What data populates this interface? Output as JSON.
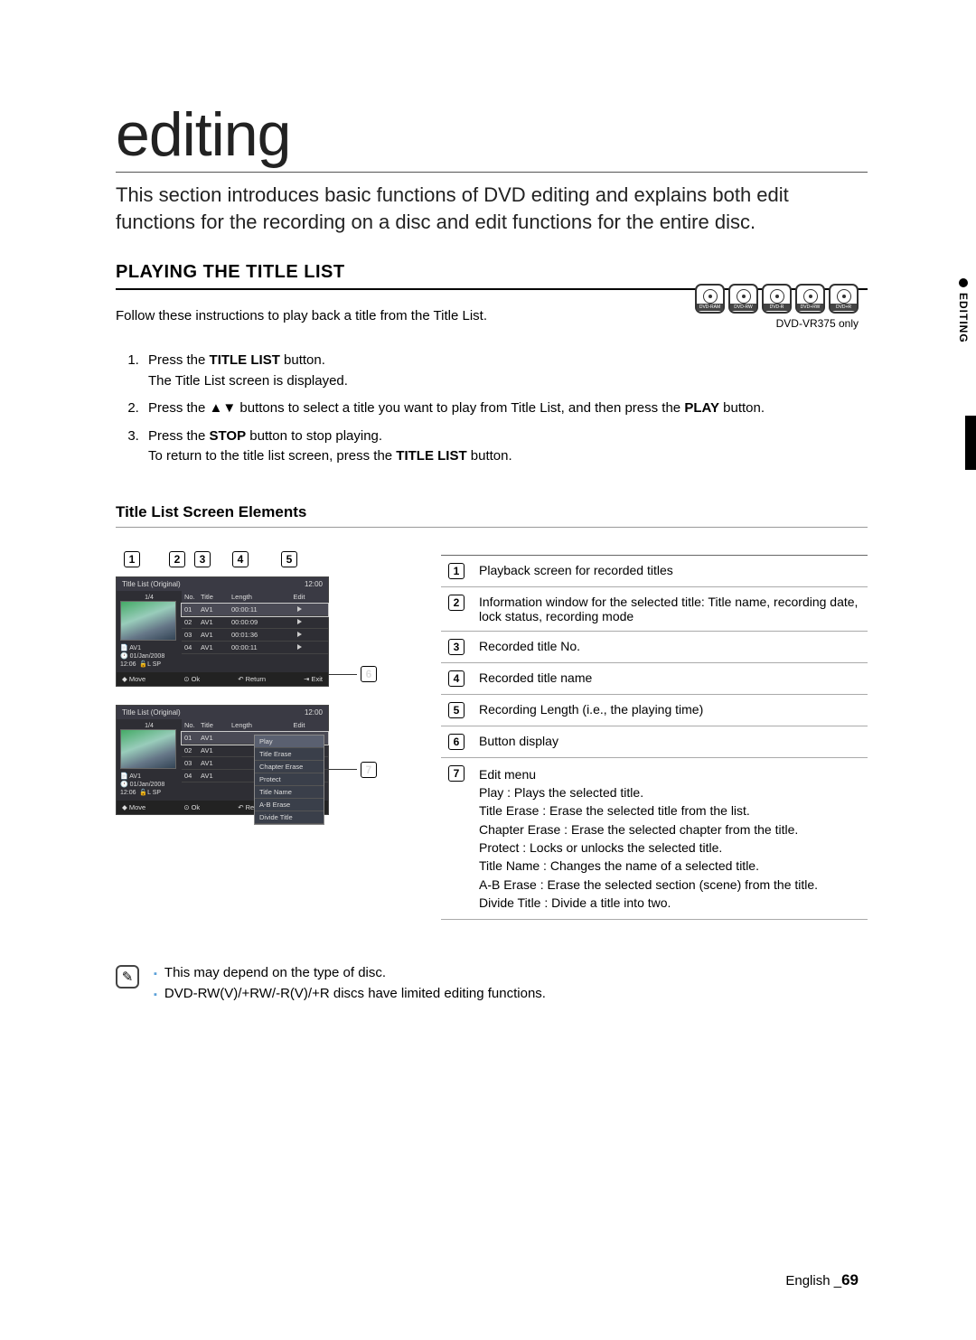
{
  "sideTab": {
    "label": "EDITING"
  },
  "header": {
    "title": "editing",
    "intro": "This section introduces basic functions of DVD editing and explains both edit functions for the recording on a disc and edit functions for the entire disc."
  },
  "section": {
    "heading": "PLAYING THE TITLE LIST",
    "follow": "Follow these instructions to play back a title from the Title List."
  },
  "discs": {
    "labels": [
      "DVD-RAM",
      "DVD-RW",
      "DVD-R",
      "DVD+RW",
      "DVD+R"
    ],
    "note": "DVD-VR375 only"
  },
  "steps": [
    {
      "lead": "Press the ",
      "bold1": "TITLE LIST",
      "tail1": " button.",
      "sub": "The Title List screen is displayed."
    },
    {
      "lead": "Press the ▲▼ buttons to select a title you want to play from Title List, and then press the ",
      "bold1": "PLAY",
      "tail1": " button."
    },
    {
      "lead": "Press the ",
      "bold1": "STOP",
      "tail1": " button to stop playing.",
      "sub": "To return to the title list screen, press the ",
      "subBold": "TITLE LIST",
      "subTail": " button."
    }
  ],
  "subheading": "Title List Screen Elements",
  "callouts": [
    "1",
    "2",
    "3",
    "4",
    "5",
    "6",
    "7"
  ],
  "shot": {
    "headerTitle": "Title List (Original)",
    "clock": "12:00",
    "page": "1/4",
    "info": {
      "name": "AV1",
      "date": "01/Jan/2008",
      "time": "12:06",
      "mode": "L SP"
    },
    "cols": {
      "no": "No.",
      "title": "Title",
      "length": "Length",
      "edit": "Edit"
    },
    "rows": [
      {
        "no": "01",
        "title": "AV1",
        "length": "00:00:11"
      },
      {
        "no": "02",
        "title": "AV1",
        "length": "00:00:09"
      },
      {
        "no": "03",
        "title": "AV1",
        "length": "00:01:36"
      },
      {
        "no": "04",
        "title": "AV1",
        "length": "00:00:11"
      }
    ],
    "footer": {
      "move": "Move",
      "ok": "Ok",
      "return": "Return",
      "exit": "Exit"
    },
    "menu": [
      "Play",
      "Title Erase",
      "Chapter Erase",
      "Protect",
      "Title Name",
      "A-B Erase",
      "Divide Title"
    ]
  },
  "ref": [
    {
      "n": "1",
      "text": "Playback screen for recorded titles"
    },
    {
      "n": "2",
      "text": "Information window for the selected title: Title name, recording date, lock status, recording mode"
    },
    {
      "n": "3",
      "text": "Recorded title No."
    },
    {
      "n": "4",
      "text": "Recorded title name"
    },
    {
      "n": "5",
      "text": "Recording Length (i.e., the playing time)"
    },
    {
      "n": "6",
      "text": "Button display"
    },
    {
      "n": "7",
      "lines": [
        "Edit menu",
        "Play : Plays the selected title.",
        "Title Erase : Erase the selected title from the list.",
        "Chapter Erase : Erase the selected chapter from the title.",
        "Protect : Locks or unlocks the selected title.",
        "Title Name : Changes the name of a selected title.",
        "A-B Erase : Erase the selected section (scene) from the title.",
        "Divide Title : Divide a title into two."
      ]
    }
  ],
  "notes": [
    "This may depend on the type of disc.",
    "DVD-RW(V)/+RW/-R(V)/+R discs have limited editing functions."
  ],
  "footer": {
    "lang": "English",
    "sep": "_",
    "page": "69"
  }
}
